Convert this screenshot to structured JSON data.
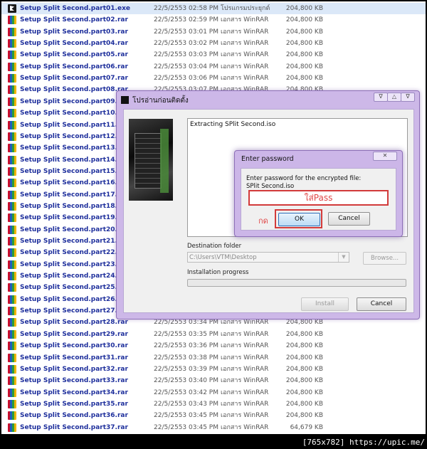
{
  "files": [
    {
      "name": "Setup Split Second.part01.exe",
      "date": "22/5/2553 02:58 PM",
      "type": "โปรแกรมประยุกต์",
      "size": "204,800 KB",
      "icon": "exe"
    },
    {
      "name": "Setup Split Second.part02.rar",
      "date": "22/5/2553 02:59 PM",
      "type": "เอกสาร WinRAR",
      "size": "204,800 KB",
      "icon": "rar"
    },
    {
      "name": "Setup Split Second.part03.rar",
      "date": "22/5/2553 03:01 PM",
      "type": "เอกสาร WinRAR",
      "size": "204,800 KB",
      "icon": "rar"
    },
    {
      "name": "Setup Split Second.part04.rar",
      "date": "22/5/2553 03:02 PM",
      "type": "เอกสาร WinRAR",
      "size": "204,800 KB",
      "icon": "rar"
    },
    {
      "name": "Setup Split Second.part05.rar",
      "date": "22/5/2553 03:03 PM",
      "type": "เอกสาร WinRAR",
      "size": "204,800 KB",
      "icon": "rar"
    },
    {
      "name": "Setup Split Second.part06.rar",
      "date": "22/5/2553 03:04 PM",
      "type": "เอกสาร WinRAR",
      "size": "204,800 KB",
      "icon": "rar"
    },
    {
      "name": "Setup Split Second.part07.rar",
      "date": "22/5/2553 03:06 PM",
      "type": "เอกสาร WinRAR",
      "size": "204,800 KB",
      "icon": "rar"
    },
    {
      "name": "Setup Split Second.part08.rar",
      "date": "22/5/2553 03:07 PM",
      "type": "เอกสาร WinRAR",
      "size": "204,800 KB",
      "icon": "rar"
    },
    {
      "name": "Setup Split Second.part09.rar",
      "date": "",
      "type": "",
      "size": "",
      "icon": "rar"
    },
    {
      "name": "Setup Split Second.part10.rar",
      "date": "",
      "type": "",
      "size": "",
      "icon": "rar"
    },
    {
      "name": "Setup Split Second.part11.rar",
      "date": "",
      "type": "",
      "size": "",
      "icon": "rar"
    },
    {
      "name": "Setup Split Second.part12.rar",
      "date": "",
      "type": "",
      "size": "",
      "icon": "rar"
    },
    {
      "name": "Setup Split Second.part13.rar",
      "date": "",
      "type": "",
      "size": "",
      "icon": "rar"
    },
    {
      "name": "Setup Split Second.part14.rar",
      "date": "",
      "type": "",
      "size": "",
      "icon": "rar"
    },
    {
      "name": "Setup Split Second.part15.rar",
      "date": "",
      "type": "",
      "size": "",
      "icon": "rar"
    },
    {
      "name": "Setup Split Second.part16.rar",
      "date": "",
      "type": "",
      "size": "",
      "icon": "rar"
    },
    {
      "name": "Setup Split Second.part17.rar",
      "date": "",
      "type": "",
      "size": "",
      "icon": "rar"
    },
    {
      "name": "Setup Split Second.part18.rar",
      "date": "",
      "type": "",
      "size": "",
      "icon": "rar"
    },
    {
      "name": "Setup Split Second.part19.rar",
      "date": "",
      "type": "",
      "size": "",
      "icon": "rar"
    },
    {
      "name": "Setup Split Second.part20.rar",
      "date": "",
      "type": "",
      "size": "",
      "icon": "rar"
    },
    {
      "name": "Setup Split Second.part21.rar",
      "date": "",
      "type": "",
      "size": "",
      "icon": "rar"
    },
    {
      "name": "Setup Split Second.part22.rar",
      "date": "",
      "type": "",
      "size": "",
      "icon": "rar"
    },
    {
      "name": "Setup Split Second.part23.rar",
      "date": "",
      "type": "",
      "size": "",
      "icon": "rar"
    },
    {
      "name": "Setup Split Second.part24.rar",
      "date": "",
      "type": "",
      "size": "",
      "icon": "rar"
    },
    {
      "name": "Setup Split Second.part25.rar",
      "date": "",
      "type": "",
      "size": "",
      "icon": "rar"
    },
    {
      "name": "Setup Split Second.part26.rar",
      "date": "",
      "type": "",
      "size": "",
      "icon": "rar"
    },
    {
      "name": "Setup Split Second.part27.rar",
      "date": "",
      "type": "",
      "size": "",
      "icon": "rar"
    },
    {
      "name": "Setup Split Second.part28.rar",
      "date": "22/5/2553 03:34 PM",
      "type": "เอกสาร WinRAR",
      "size": "204,800 KB",
      "icon": "rar"
    },
    {
      "name": "Setup Split Second.part29.rar",
      "date": "22/5/2553 03:35 PM",
      "type": "เอกสาร WinRAR",
      "size": "204,800 KB",
      "icon": "rar"
    },
    {
      "name": "Setup Split Second.part30.rar",
      "date": "22/5/2553 03:36 PM",
      "type": "เอกสาร WinRAR",
      "size": "204,800 KB",
      "icon": "rar"
    },
    {
      "name": "Setup Split Second.part31.rar",
      "date": "22/5/2553 03:38 PM",
      "type": "เอกสาร WinRAR",
      "size": "204,800 KB",
      "icon": "rar"
    },
    {
      "name": "Setup Split Second.part32.rar",
      "date": "22/5/2553 03:39 PM",
      "type": "เอกสาร WinRAR",
      "size": "204,800 KB",
      "icon": "rar"
    },
    {
      "name": "Setup Split Second.part33.rar",
      "date": "22/5/2553 03:40 PM",
      "type": "เอกสาร WinRAR",
      "size": "204,800 KB",
      "icon": "rar"
    },
    {
      "name": "Setup Split Second.part34.rar",
      "date": "22/5/2553 03:42 PM",
      "type": "เอกสาร WinRAR",
      "size": "204,800 KB",
      "icon": "rar"
    },
    {
      "name": "Setup Split Second.part35.rar",
      "date": "22/5/2553 03:43 PM",
      "type": "เอกสาร WinRAR",
      "size": "204,800 KB",
      "icon": "rar"
    },
    {
      "name": "Setup Split Second.part36.rar",
      "date": "22/5/2553 03:45 PM",
      "type": "เอกสาร WinRAR",
      "size": "204,800 KB",
      "icon": "rar"
    },
    {
      "name": "Setup Split Second.part37.rar",
      "date": "22/5/2553 03:45 PM",
      "type": "เอกสาร WinRAR",
      "size": "64,679 KB",
      "icon": "rar"
    }
  ],
  "installer": {
    "title": "โปรอ่านก่อนติดตั้ง",
    "log_text": "Extracting SPlit Second.iso",
    "dest_label": "Destination folder",
    "dest_value": "C:\\Users\\VTM\\Desktop",
    "browse_label": "Browse...",
    "progress_label": "Installation progress",
    "install_label": "Install",
    "cancel_label": "Cancel"
  },
  "password_dialog": {
    "title": "Enter password",
    "prompt": "Enter password for the encrypted file:",
    "file": "SPlit Second.iso",
    "password_hint": "ใส่Pass",
    "annotation": "กด",
    "ok_label": "OK",
    "cancel_label": "Cancel",
    "highlight_color": "#d23a3a"
  },
  "watermark": "[765x782] https://upic.me/"
}
